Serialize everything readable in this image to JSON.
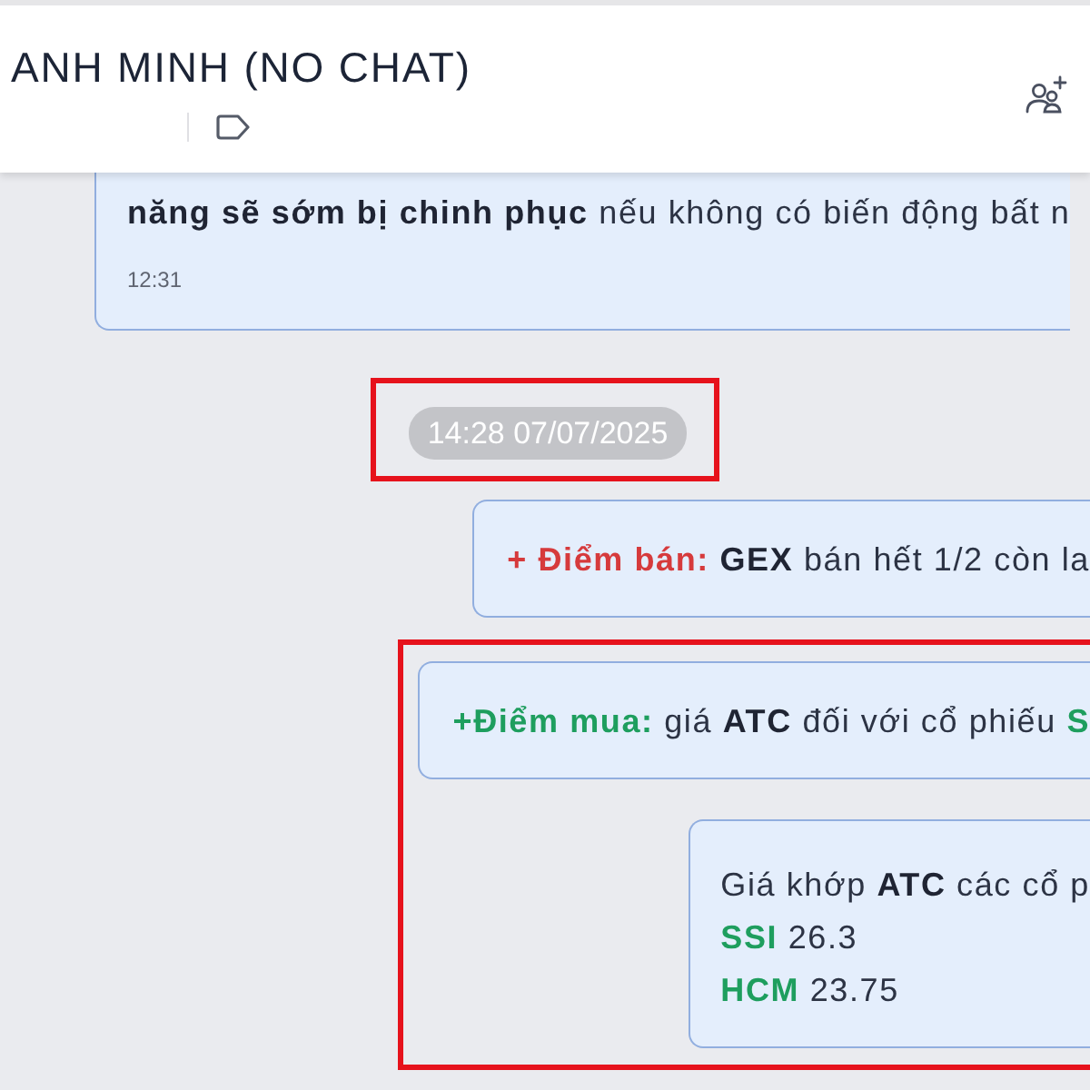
{
  "header": {
    "title": "ANH MINH (NO CHAT)"
  },
  "messages": [
    {
      "kind": "text",
      "outgoing": false,
      "lines": [
        [
          {
            "text": "năng sẽ sớm bị chinh phục",
            "kind": "strong"
          },
          {
            "text": " nếu không có biến động bất n",
            "kind": "plain"
          }
        ]
      ],
      "time": "12:31"
    },
    {
      "kind": "date",
      "text": "14:28 07/07/2025",
      "highlighted": true
    },
    {
      "kind": "text",
      "outgoing": true,
      "lines": [
        [
          {
            "text": "+ Điểm bán:",
            "kind": "sell"
          },
          {
            "text": " GEX",
            "kind": "strong"
          },
          {
            "text": " bán hết 1/2 còn la",
            "kind": "plain"
          }
        ]
      ]
    },
    {
      "kind": "group",
      "highlighted": true,
      "items": [
        {
          "kind": "text",
          "outgoing": true,
          "lines": [
            [
              {
                "text": "+Điểm mua:",
                "kind": "buy"
              },
              {
                "text": " giá ",
                "kind": "plain"
              },
              {
                "text": "ATC",
                "kind": "strong"
              },
              {
                "text": " đối với cổ phiếu ",
                "kind": "plain"
              },
              {
                "text": "S",
                "kind": "buy"
              }
            ]
          ]
        },
        {
          "kind": "text",
          "outgoing": true,
          "lines": [
            [
              {
                "text": "Giá khớp ",
                "kind": "plain"
              },
              {
                "text": "ATC",
                "kind": "strong"
              },
              {
                "text": " các cổ p",
                "kind": "plain"
              }
            ],
            [
              {
                "text": "SSI",
                "kind": "buy"
              },
              {
                "text": " 26.3",
                "kind": "plain"
              }
            ],
            [
              {
                "text": "HCM",
                "kind": "buy"
              },
              {
                "text": " 23.75",
                "kind": "plain"
              }
            ]
          ]
        }
      ]
    }
  ]
}
